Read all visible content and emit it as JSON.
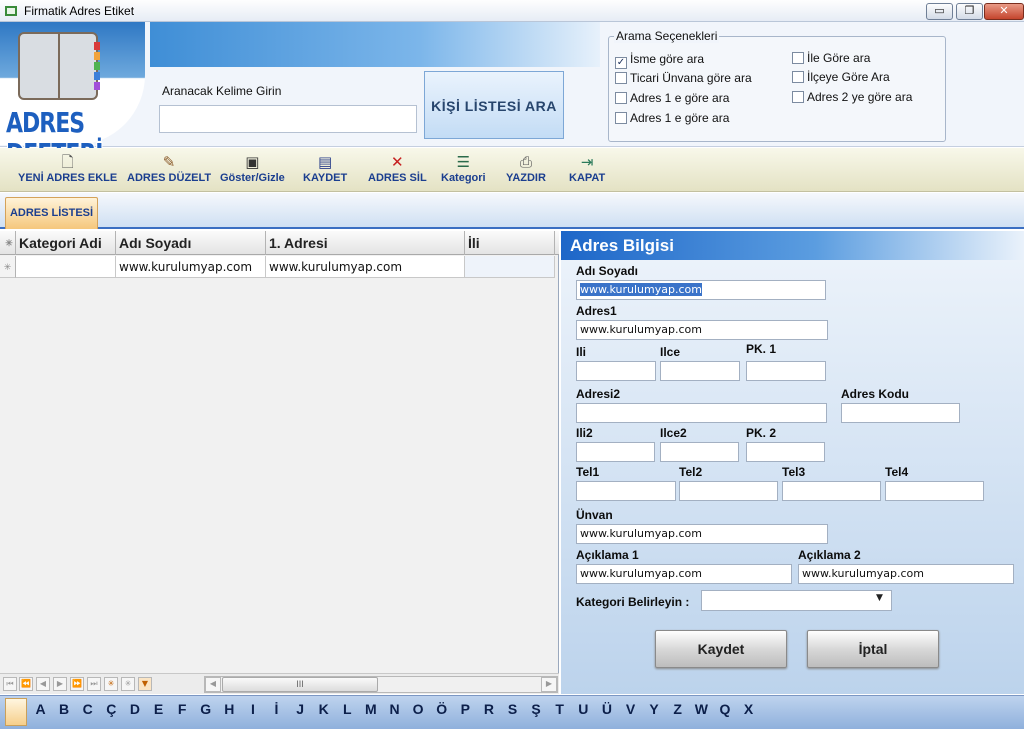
{
  "window": {
    "title": "Firmatik Adres Etiket",
    "controls": {
      "minimize": "▭",
      "maximize": "❐",
      "close": "✕"
    }
  },
  "header": {
    "logo_text": "ADRES DEFTERİ",
    "search_label": "Aranacak Kelime Girin",
    "search_value": "",
    "search_button": "KİŞİ LİSTESİ ARA"
  },
  "search_options": {
    "legend": "Arama Seçenekleri",
    "items": [
      {
        "label": "İsme göre ara",
        "checked": true
      },
      {
        "label": "Ticari Ünvana göre ara",
        "checked": false
      },
      {
        "label": "Adres 1 e göre ara",
        "checked": false
      },
      {
        "label": "Adres 1 e göre ara",
        "checked": false
      },
      {
        "label": "İle Göre ara",
        "checked": false
      },
      {
        "label": "İlçeye Göre Ara",
        "checked": false
      },
      {
        "label": "Adres 2 ye göre ara",
        "checked": false
      }
    ]
  },
  "toolbar": {
    "new_label": "YENİ ADRES EKLE",
    "edit_label": "ADRES DÜZELT",
    "toggle_label": "Göster/Gizle",
    "save_label": "KAYDET",
    "delete_label": "ADRES SİL",
    "category_label": "Kategori",
    "print_label": "YAZDIR",
    "close_label": "KAPAT"
  },
  "tabs": {
    "list": "ADRES LİSTESİ"
  },
  "grid": {
    "columns": [
      "Kategori Adi",
      "Adı Soyadı",
      "1. Adresi",
      "İli"
    ],
    "rows": [
      {
        "kategori": "",
        "adi_soyadi": "www.kurulumyap.com",
        "adres1": "www.kurulumyap.com",
        "ili": ""
      }
    ],
    "scroll_thumb": "III"
  },
  "details": {
    "title": "Adres Bilgisi",
    "labels": {
      "adi_soyadi": "Adı Soyadı",
      "adres1": "Adres1",
      "ili": "Ili",
      "ilce": "Ilce",
      "pk1": "PK. 1",
      "adresi2": "Adresi2",
      "adres_kodu": "Adres Kodu",
      "ili2": "Ili2",
      "ilce2": "Ilce2",
      "pk2": "PK. 2",
      "tel1": "Tel1",
      "tel2": "Tel2",
      "tel3": "Tel3",
      "tel4": "Tel4",
      "unvan": "Ünvan",
      "aciklama1": "Açıklama 1",
      "aciklama2": "Açıklama 2",
      "kategori": "Kategori Belirleyin :"
    },
    "values": {
      "adi_soyadi": "www.kurulumyap.com",
      "adres1": "www.kurulumyap.com",
      "ili": "",
      "ilce": "",
      "pk1": "",
      "adresi2": "",
      "adres_kodu": "",
      "ili2": "",
      "ilce2": "",
      "pk2": "",
      "tel1": "",
      "tel2": "",
      "tel3": "",
      "tel4": "",
      "unvan": "www.kurulumyap.com",
      "aciklama1": "www.kurulumyap.com",
      "aciklama2": "www.kurulumyap.com",
      "kategori": ""
    },
    "save_button": "Kaydet",
    "cancel_button": "İptal"
  },
  "alphabet": [
    "A",
    "B",
    "C",
    "Ç",
    "D",
    "E",
    "F",
    "G",
    "H",
    "I",
    "İ",
    "J",
    "K",
    "L",
    "M",
    "N",
    "O",
    "Ö",
    "P",
    "R",
    "S",
    "Ş",
    "T",
    "U",
    "Ü",
    "V",
    "Y",
    "Z",
    "W",
    "Q",
    "X"
  ],
  "colors": {
    "accent_blue": "#1d66c8",
    "toolbar_text": "#1b3e8f",
    "tab_orange": "#f5c77c"
  }
}
